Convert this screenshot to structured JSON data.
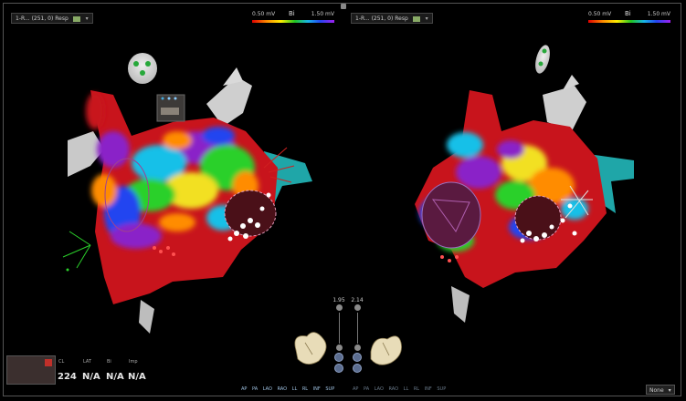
{
  "toolbar": {
    "left_series": "1-R... (251, 0) Resp",
    "right_series": "1-R... (251, 0) Resp"
  },
  "scale": {
    "left": {
      "min": "0.50 mV",
      "max": "1.50 mV",
      "label": "Bi"
    },
    "right": {
      "min": "0.50 mV",
      "max": "1.50 mV",
      "label": "Bi"
    }
  },
  "sliders": {
    "left_value": "1.95",
    "right_value": "2.14"
  },
  "metrics": {
    "labels": [
      "CL",
      "LAT",
      "Bi",
      "Imp"
    ],
    "values": [
      "224",
      "N/A",
      "N/A",
      "N/A"
    ]
  },
  "views": {
    "left": [
      "AP",
      "PA",
      "LAO",
      "RAO",
      "LL",
      "RL",
      "INF",
      "SUP"
    ],
    "right": [
      "AP",
      "PA",
      "LAO",
      "RAO",
      "LL",
      "RL",
      "INF",
      "SUP"
    ]
  },
  "none_select": "None",
  "colors": {
    "bg": "#000000",
    "scale_low": "#e00000",
    "scale_high": "#a020f0",
    "tube": "#1fa6a8"
  }
}
